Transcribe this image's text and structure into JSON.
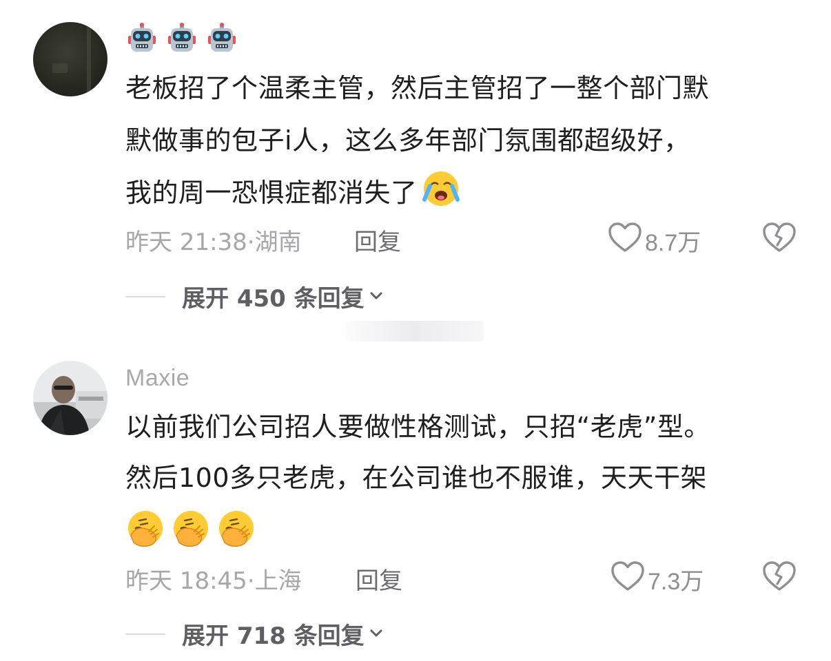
{
  "comments": [
    {
      "username": "",
      "username_emojis": [
        "robot-icon",
        "robot-icon",
        "robot-icon"
      ],
      "lines": [
        "老板招了个温柔主管，然后主管招了一整个部门默",
        "默做事的包子i人，这么多年部门氛围都超级好，",
        "我的周一恐惧症都消失了"
      ],
      "trailing_emojis": [
        "loudly-crying-face-icon"
      ],
      "time": "昨天 21:38",
      "separator": "·",
      "location": "湖南",
      "reply_label": "回复",
      "likes": "8.7万",
      "expand_label": "展开 450 条回复"
    },
    {
      "username": "Maxie",
      "username_emojis": [],
      "lines": [
        "以前我们公司招人要做性格测试，只招“老虎”型。",
        "然后100多只老虎，在公司谁也不服谁，天天干架"
      ],
      "trailing_emojis": [
        "face-palm-icon",
        "face-palm-icon",
        "face-palm-icon"
      ],
      "time": "昨天 18:45",
      "separator": "·",
      "location": "上海",
      "reply_label": "回复",
      "likes": "7.3万",
      "expand_label": "展开 718 条回复"
    }
  ],
  "colors": {
    "text": "#1e1e1e",
    "meta": "#a6a6ab",
    "reply": "#6c6c70",
    "expand": "#5e5e63",
    "emoji_yellow": "#ffcc33"
  }
}
